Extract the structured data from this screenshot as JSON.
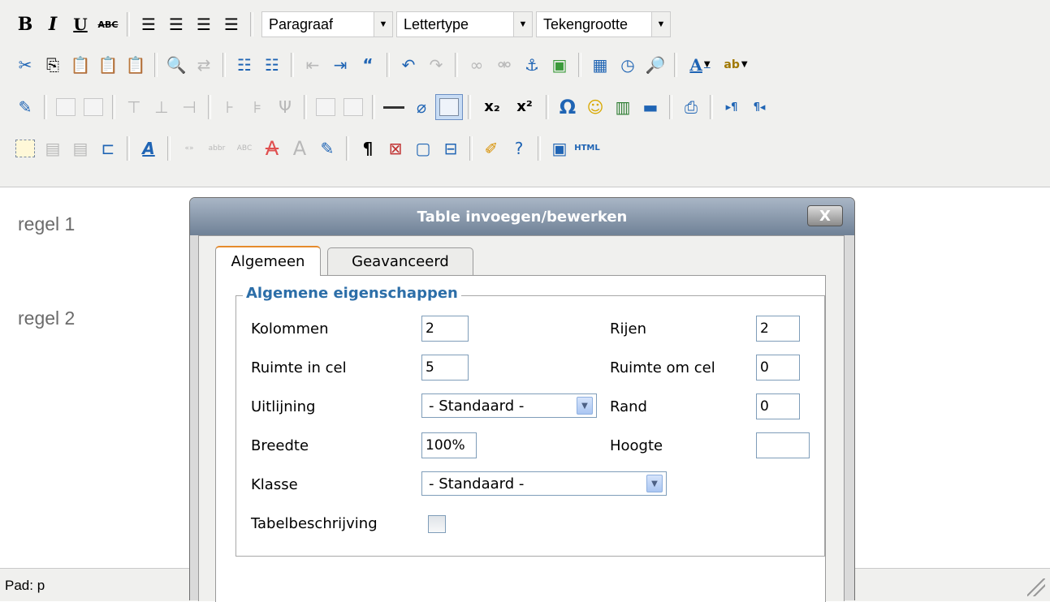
{
  "toolbar": {
    "row1": {
      "bold": "B",
      "italic": "I",
      "underline": "U",
      "strikethrough": "ABC",
      "format_select": "Paragraaf",
      "font_select": "Lettertype",
      "size_select": "Tekengrootte"
    },
    "row2": {
      "icons": [
        "cut-icon",
        "copy-icon",
        "paste-icon",
        "paste-text-icon",
        "paste-word-icon",
        "find-icon",
        "replace-icon",
        "bullet-list-icon",
        "numbered-list-icon",
        "outdent-icon",
        "indent-icon",
        "blockquote-icon",
        "undo-icon",
        "redo-icon",
        "link-icon",
        "unlink-icon",
        "anchor-icon",
        "image-icon",
        "insert-date-icon",
        "insert-time-icon",
        "preview-icon",
        "text-color-icon",
        "highlight-color-icon"
      ]
    },
    "row3": {
      "subscript": "x₂",
      "superscript": "x²",
      "omega": "Ω"
    },
    "row4": {
      "html_button": "HTML"
    }
  },
  "editor": {
    "paragraph1": "regel 1",
    "paragraph2": "regel 2"
  },
  "statusbar": {
    "path": "Pad: p"
  },
  "dialog": {
    "title": "Table invoegen/bewerken",
    "close_label": "X",
    "tabs": [
      {
        "label": "Algemeen",
        "active": true
      },
      {
        "label": "Geavanceerd",
        "active": false
      }
    ],
    "fieldset_legend": "Algemene eigenschappen",
    "fields": {
      "columns_label": "Kolommen",
      "columns_value": "2",
      "rows_label": "Rijen",
      "rows_value": "2",
      "cellpadding_label": "Ruimte in cel",
      "cellpadding_value": "5",
      "cellspacing_label": "Ruimte om cel",
      "cellspacing_value": "0",
      "align_label": "Uitlijning",
      "align_value": "- Standaard -",
      "border_label": "Rand",
      "border_value": "0",
      "width_label": "Breedte",
      "width_value": "100%",
      "height_label": "Hoogte",
      "height_value": "",
      "class_label": "Klasse",
      "class_value": "- Standaard -",
      "caption_label": "Tabelbeschrijving",
      "caption_checked": false
    }
  },
  "colors": {
    "accent_blue": "#2c6ea8",
    "title_bar": "#8595a8",
    "tab_highlight": "#e68b2c"
  }
}
